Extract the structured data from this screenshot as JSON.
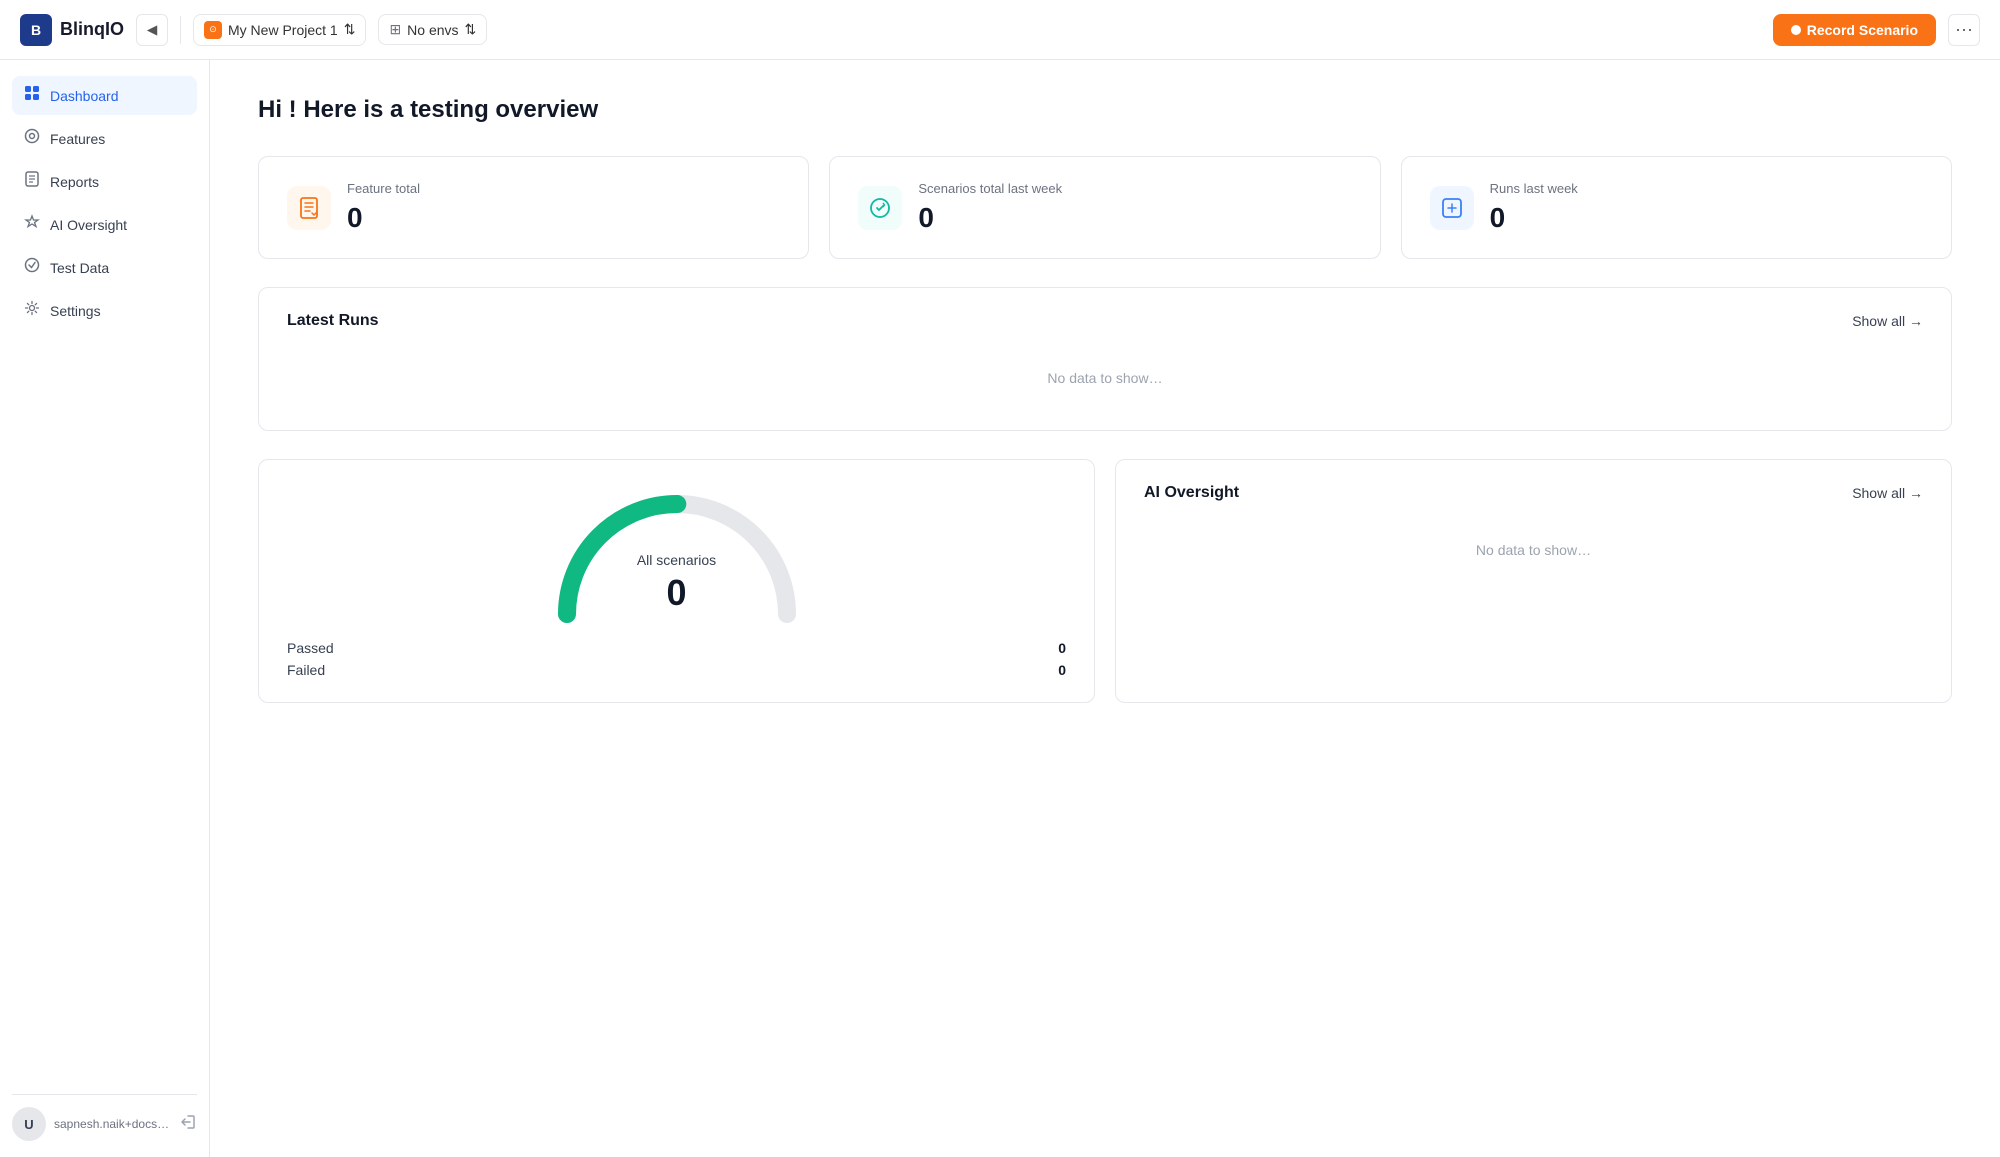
{
  "app": {
    "name": "BlinqIO"
  },
  "topbar": {
    "collapse_label": "◀",
    "project_name": "My New Project 1",
    "envs_label": "No envs",
    "record_button": "Record Scenario",
    "more_button": "···"
  },
  "sidebar": {
    "items": [
      {
        "id": "dashboard",
        "label": "Dashboard",
        "icon": "⊙",
        "active": true
      },
      {
        "id": "features",
        "label": "Features",
        "icon": "◎",
        "active": false
      },
      {
        "id": "reports",
        "label": "Reports",
        "icon": "▦",
        "active": false
      },
      {
        "id": "ai-oversight",
        "label": "AI Oversight",
        "icon": "✧",
        "active": false
      },
      {
        "id": "test-data",
        "label": "Test Data",
        "icon": "⊛",
        "active": false
      },
      {
        "id": "settings",
        "label": "Settings",
        "icon": "⚙",
        "active": false
      }
    ],
    "user_email": "sapnesh.naik+docs@...",
    "user_initial": "U"
  },
  "main": {
    "page_title": "Hi ! Here is a testing overview",
    "stats": [
      {
        "id": "feature-total",
        "label": "Feature total",
        "value": "0",
        "icon_type": "orange"
      },
      {
        "id": "scenarios-total",
        "label": "Scenarios total last week",
        "value": "0",
        "icon_type": "teal"
      },
      {
        "id": "runs-last-week",
        "label": "Runs last week",
        "value": "0",
        "icon_type": "blue"
      }
    ],
    "latest_runs": {
      "title": "Latest Runs",
      "show_all": "Show all →",
      "no_data": "No data to show…"
    },
    "gauge": {
      "label": "All scenarios",
      "value": "0",
      "passed_label": "Passed",
      "passed_value": "0",
      "failed_label": "Failed",
      "failed_value": "0"
    },
    "ai_oversight": {
      "title": "AI Oversight",
      "show_all": "Show all →",
      "no_data": "No data to show…"
    }
  },
  "colors": {
    "accent": "#f97316",
    "active_nav": "#2563eb",
    "gauge_stroke": "#10b981"
  }
}
